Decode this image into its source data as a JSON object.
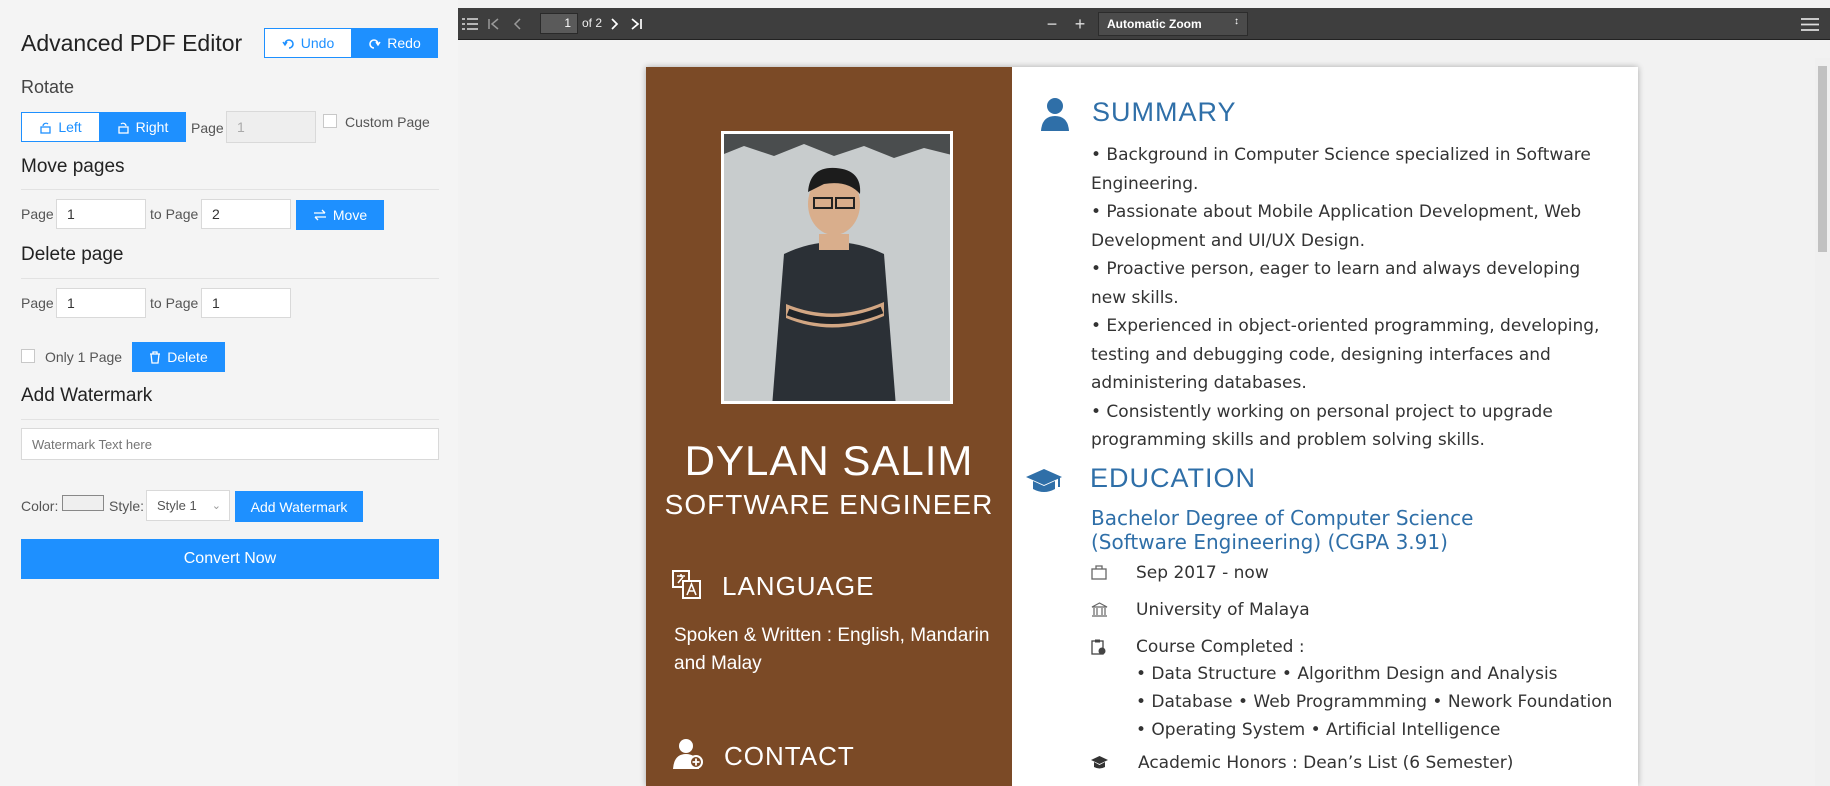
{
  "editor": {
    "title": "Advanced PDF Editor",
    "undo_label": "Undo",
    "redo_label": "Redo",
    "rotate": {
      "heading": "Rotate",
      "left_label": "Left",
      "right_label": "Right",
      "page_label": "Page",
      "page_value": "1",
      "custom_page_label": "Custom Page"
    },
    "move": {
      "heading": "Move pages",
      "page_label": "Page",
      "page_value": "1",
      "to_label": "to Page",
      "to_value": "2",
      "button_label": "Move"
    },
    "delete": {
      "heading": "Delete page",
      "page_label": "Page",
      "page_value": "1",
      "to_label": "to Page",
      "to_value": "1",
      "only_one_label": "Only 1 Page",
      "button_label": "Delete"
    },
    "watermark": {
      "heading": "Add Watermark",
      "placeholder": "Watermark Text here",
      "color_label": "Color:",
      "style_label": "Style:",
      "style_value": "Style 1",
      "button_label": "Add Watermark"
    },
    "convert_label": "Convert Now",
    "accent_color": "#1e90ff"
  },
  "viewer": {
    "page_number": "1",
    "page_total": "of 2",
    "zoom": "Automatic Zoom"
  },
  "resume": {
    "name": "DYLAN SALIM",
    "role": "SOFTWARE ENGINEER",
    "language_heading": "LANGUAGE",
    "language_text": "Spoken & Written : English, Mandarin and Malay",
    "contact_heading": "CONTACT",
    "summary_heading": "SUMMARY",
    "summary_lines": [
      "• Background in Computer Science specialized in Software",
      "Engineering.",
      "• Passionate about Mobile Application Development, Web",
      "Development and UI/UX Design.",
      "• Proactive person, eager to learn and always developing",
      "new skills.",
      "• Experienced in object-oriented programming, developing,",
      "testing and debugging code, designing interfaces and",
      "administering databases.",
      "• Consistently working on personal project to upgrade",
      "programming skills and problem solving skills."
    ],
    "education_heading": "EDUCATION",
    "degree_line1": "Bachelor Degree of Computer Science",
    "degree_line2": "(Software Engineering) (CGPA 3.91)",
    "period": "Sep 2017 - now",
    "university": "University of Malaya",
    "course_heading": "Course Completed :",
    "course_lines": [
      "• Data Structure • Algorithm Design and Analysis",
      "• Database • Web Programmming • Nework Foundation",
      "• Operating System • Artificial Intelligence"
    ],
    "honors": "Academic Honors : Dean’s List (6 Semester)",
    "sidebar_color": "#7b4a26",
    "heading_color": "#2f6fa8"
  }
}
